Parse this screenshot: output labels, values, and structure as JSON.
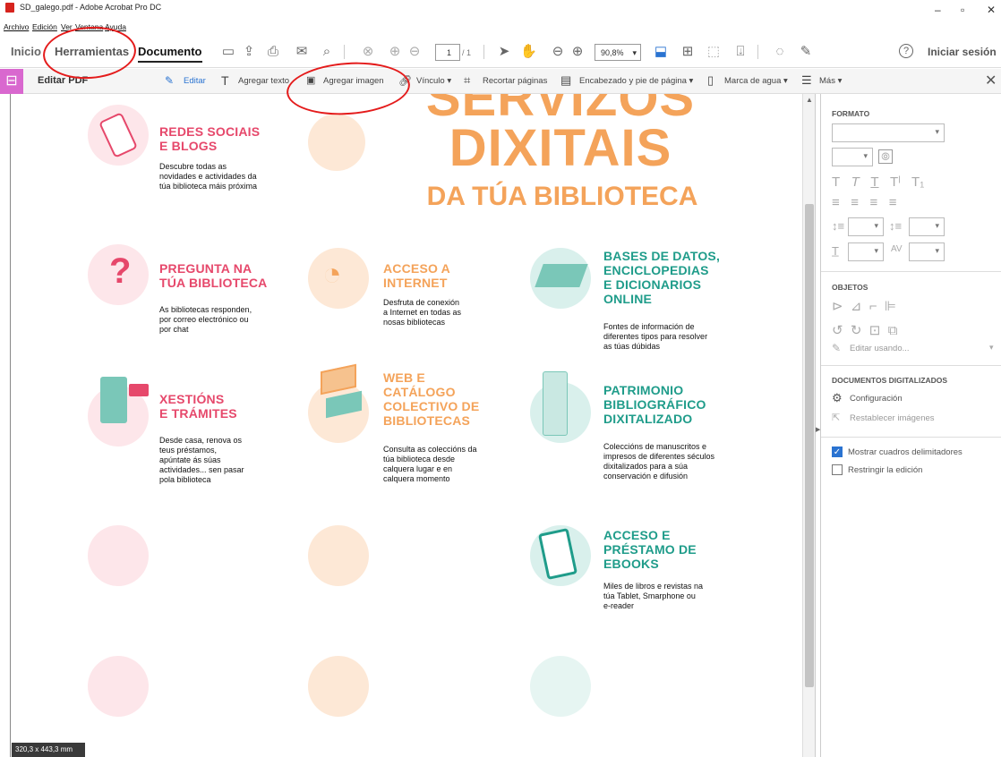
{
  "window": {
    "title": "SD_galego.pdf - Adobe Acrobat Pro DC",
    "min": "–",
    "max": "▫",
    "close": "✕"
  },
  "menubar": [
    "Archivo",
    "Edición",
    "Ver",
    "Ventana",
    "Ayuda"
  ],
  "tabs": {
    "home": "Inicio",
    "tools": "Herramientas",
    "document": "Documento"
  },
  "toolbar": {
    "page_current": "1",
    "page_total": "/ 1",
    "zoom": "90,8%",
    "sign_in": "Iniciar sesión",
    "help": "?"
  },
  "edit_toolbar": {
    "title": "Editar PDF",
    "edit": "Editar",
    "add_text": "Agregar texto",
    "add_image": "Agregar imagen",
    "link": "Vínculo ▾",
    "crop": "Recortar páginas",
    "header_footer": "Encabezado y pie de página ▾",
    "watermark": "Marca de agua ▾",
    "more": "Más ▾",
    "close": "✕"
  },
  "document": {
    "big_title": [
      "SERVIZOS",
      "DIXITAIS",
      "DA TÚA BIBLIOTECA"
    ],
    "services": [
      {
        "title": "REDES SOCIAIS\nE BLOGS",
        "body": "Descubre todas as\nnovidades e actividades da\ntúa biblioteca máis próxima",
        "color": "pink"
      },
      {
        "title": "PREGUNTA NA\nTÚA BIBLIOTECA",
        "body": "As bibliotecas responden,\npor correo electrónico ou\npor chat",
        "color": "pink"
      },
      {
        "title": "ACCESO A\nINTERNET",
        "body": "Desfruta de conexión\na Internet en todas as\nnosas bibliotecas",
        "color": "orange"
      },
      {
        "title": "BASES DE DATOS,\nENCICLOPEDIAS\nE DICIONARIOS\nONLINE",
        "body": "Fontes de información de\ndiferentes tipos para resolver\nas túas dúbidas",
        "color": "teal"
      },
      {
        "title": "XESTIÓNS\nE TRÁMITES",
        "body": "Desde casa, renova os\nteus préstamos,\napúntate ás súas\nactividades... sen pasar\npola biblioteca",
        "color": "pink"
      },
      {
        "title": "WEB E\nCATÁLOGO\nCOLECTIVO DE\nBIBLIOTECAS",
        "body": "Consulta as coleccións da\ntúa biblioteca desde\ncalquera lugar e en\ncalquera momento",
        "color": "orange"
      },
      {
        "title": "PATRIMONIO\nBIBLIOGRÁFICO\nDIXITALIZADO",
        "body": "Coleccións de manuscritos e\nimpresos de diferentes séculos\ndixitalizados para a súa\nconservación e difusión",
        "color": "teal"
      },
      {
        "title": "ACCESO E\nPRÉSTAMO DE\nEBOOKS",
        "body": "Miles de libros e revistas na\ntúa Tablet, Smarphone ou\ne-reader",
        "color": "teal"
      }
    ]
  },
  "right_panel": {
    "format_header": "FORMATO",
    "objects_header": "OBJETOS",
    "edit_using": "Editar usando...",
    "scanned_header": "DOCUMENTOS DIGITALIZADOS",
    "settings": "Configuración",
    "reset_images": "Restablecer imágenes",
    "show_boxes": "Mostrar cuadros delimitadores",
    "restrict": "Restringir la edición",
    "show_boxes_checked": true,
    "restrict_checked": false
  },
  "status": {
    "size": "320,3 x 443,3 mm"
  },
  "colors": {
    "pink": "#e6486b",
    "orange": "#f4a35a",
    "teal": "#1f9c8a",
    "annotation": "#e41b1b",
    "edit_accent": "#d968cf"
  }
}
